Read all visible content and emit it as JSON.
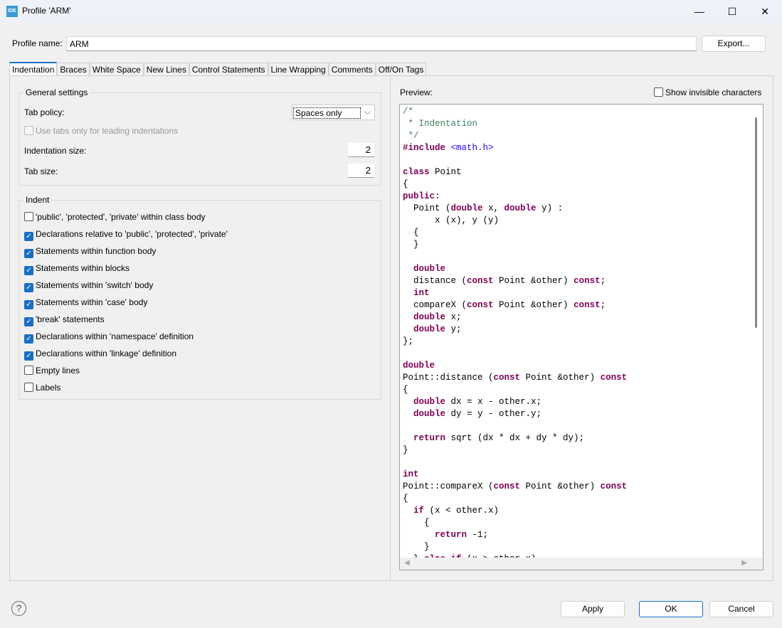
{
  "window": {
    "title": "Profile 'ARM'",
    "icon_text": "IDE",
    "minimize": "—",
    "maximize": "☐",
    "close": "✕"
  },
  "profile": {
    "label": "Profile name:",
    "value": "ARM",
    "export": "Export..."
  },
  "tabs": [
    "Indentation",
    "Braces",
    "White Space",
    "New Lines",
    "Control Statements",
    "Line Wrapping",
    "Comments",
    "Off/On Tags"
  ],
  "general": {
    "title": "General settings",
    "tab_policy_label": "Tab policy:",
    "tab_policy_value": "Spaces only",
    "use_tabs_label": "Use tabs only for leading indentations",
    "indent_size_label": "Indentation size:",
    "indent_size": "2",
    "tab_size_label": "Tab size:",
    "tab_size": "2"
  },
  "indent": {
    "title": "Indent",
    "items": [
      {
        "label": "'public', 'protected', 'private' within class body",
        "checked": false
      },
      {
        "label": "Declarations relative to 'public', 'protected', 'private'",
        "checked": true
      },
      {
        "label": "Statements within function body",
        "checked": true
      },
      {
        "label": "Statements within blocks",
        "checked": true
      },
      {
        "label": "Statements within 'switch' body",
        "checked": true
      },
      {
        "label": "Statements within 'case' body",
        "checked": true
      },
      {
        "label": "'break' statements",
        "checked": true
      },
      {
        "label": "Declarations within 'namespace' definition",
        "checked": true
      },
      {
        "label": "Declarations within 'linkage' definition",
        "checked": true
      },
      {
        "label": "Empty lines",
        "checked": false
      },
      {
        "label": "Labels",
        "checked": false
      }
    ]
  },
  "preview": {
    "label": "Preview:",
    "show_invisible": "Show invisible characters",
    "show_invisible_checked": false,
    "code": [
      [
        [
          "/*",
          "c"
        ]
      ],
      [
        [
          " * Indentation",
          "c"
        ]
      ],
      [
        [
          " */",
          "c"
        ]
      ],
      [
        [
          "#include",
          "k"
        ],
        [
          " ",
          "n"
        ],
        [
          "<math.h>",
          "s"
        ]
      ],
      [],
      [
        [
          "class",
          "k"
        ],
        [
          " Point",
          "n"
        ]
      ],
      [
        [
          "{",
          "n"
        ]
      ],
      [
        [
          "public",
          "k"
        ],
        [
          ":",
          "n"
        ]
      ],
      [
        [
          "  Point (",
          "n"
        ],
        [
          "double",
          "k"
        ],
        [
          " x, ",
          "n"
        ],
        [
          "double",
          "k"
        ],
        [
          " y) :",
          "n"
        ]
      ],
      [
        [
          "      x (x), y (y)",
          "n"
        ]
      ],
      [
        [
          "  {",
          "n"
        ]
      ],
      [
        [
          "  }",
          "n"
        ]
      ],
      [],
      [
        [
          "  ",
          "n"
        ],
        [
          "double",
          "k"
        ]
      ],
      [
        [
          "  distance (",
          "n"
        ],
        [
          "const",
          "k"
        ],
        [
          " Point &other) ",
          "n"
        ],
        [
          "const",
          "k"
        ],
        [
          ";",
          "n"
        ]
      ],
      [
        [
          "  ",
          "n"
        ],
        [
          "int",
          "k"
        ]
      ],
      [
        [
          "  compareX (",
          "n"
        ],
        [
          "const",
          "k"
        ],
        [
          " Point &other) ",
          "n"
        ],
        [
          "const",
          "k"
        ],
        [
          ";",
          "n"
        ]
      ],
      [
        [
          "  ",
          "n"
        ],
        [
          "double",
          "k"
        ],
        [
          " x;",
          "n"
        ]
      ],
      [
        [
          "  ",
          "n"
        ],
        [
          "double",
          "k"
        ],
        [
          " y;",
          "n"
        ]
      ],
      [
        [
          "};",
          "n"
        ]
      ],
      [],
      [
        [
          "double",
          "k"
        ]
      ],
      [
        [
          "Point::distance (",
          "n"
        ],
        [
          "const",
          "k"
        ],
        [
          " Point &other) ",
          "n"
        ],
        [
          "const",
          "k"
        ]
      ],
      [
        [
          "{",
          "n"
        ]
      ],
      [
        [
          "  ",
          "n"
        ],
        [
          "double",
          "k"
        ],
        [
          " dx = x - other.x;",
          "n"
        ]
      ],
      [
        [
          "  ",
          "n"
        ],
        [
          "double",
          "k"
        ],
        [
          " dy = y - other.y;",
          "n"
        ]
      ],
      [],
      [
        [
          "  ",
          "n"
        ],
        [
          "return",
          "k"
        ],
        [
          " sqrt (dx * dx + dy * dy);",
          "n"
        ]
      ],
      [
        [
          "}",
          "n"
        ]
      ],
      [],
      [
        [
          "int",
          "k"
        ]
      ],
      [
        [
          "Point::compareX (",
          "n"
        ],
        [
          "const",
          "k"
        ],
        [
          " Point &other) ",
          "n"
        ],
        [
          "const",
          "k"
        ]
      ],
      [
        [
          "{",
          "n"
        ]
      ],
      [
        [
          "  ",
          "n"
        ],
        [
          "if",
          "k"
        ],
        [
          " (x < other.x)",
          "n"
        ]
      ],
      [
        [
          "    {",
          "n"
        ]
      ],
      [
        [
          "      ",
          "n"
        ],
        [
          "return",
          "k"
        ],
        [
          " -1;",
          "n"
        ]
      ],
      [
        [
          "    }",
          "n"
        ]
      ],
      [
        [
          "  } ",
          "n"
        ],
        [
          "else if",
          "k"
        ],
        [
          " (x > other.x)",
          "n"
        ]
      ]
    ]
  },
  "buttons": {
    "apply": "Apply",
    "ok": "OK",
    "cancel": "Cancel",
    "help": "?"
  }
}
